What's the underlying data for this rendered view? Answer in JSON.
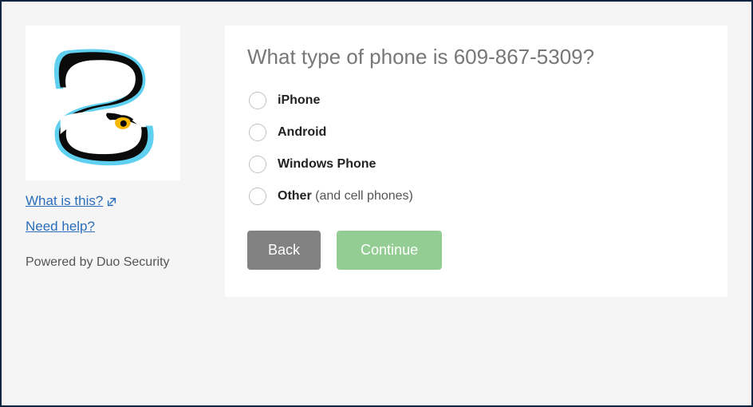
{
  "sidebar": {
    "links": {
      "what_is_this": "What is this?",
      "need_help": "Need help?"
    },
    "powered_by": "Powered by Duo Security"
  },
  "panel": {
    "heading_prefix": "What type of phone is ",
    "phone_number": "609-867-5309",
    "heading_suffix": "?",
    "options": [
      {
        "label": "iPhone",
        "hint": ""
      },
      {
        "label": "Android",
        "hint": ""
      },
      {
        "label": "Windows Phone",
        "hint": ""
      },
      {
        "label": "Other",
        "hint": " (and cell phones)"
      }
    ],
    "buttons": {
      "back": "Back",
      "continue": "Continue"
    }
  }
}
